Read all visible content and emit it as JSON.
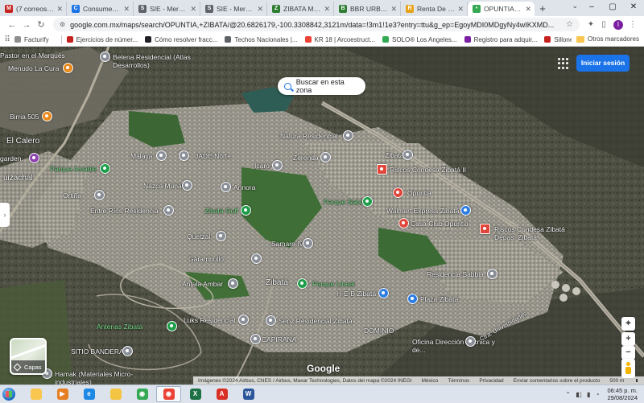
{
  "browser": {
    "tabs": [
      {
        "title": "(7 correos no",
        "icon": "gmail-icon",
        "color": "#c5221f",
        "glyph": "M"
      },
      {
        "title": "Consumer Pro",
        "icon": "consumer-icon",
        "color": "#1a73e8",
        "glyph": "C"
      },
      {
        "title": "SIE - Mercad",
        "icon": "sie-icon",
        "color": "#5f6368",
        "glyph": "S"
      },
      {
        "title": "SIE - Mercad",
        "icon": "sie-icon",
        "color": "#5f6368",
        "glyph": "S"
      },
      {
        "title": "ZIBATA MAPA",
        "icon": "zibata-icon",
        "color": "#2e7d32",
        "glyph": "Z"
      },
      {
        "title": "BBR URBAN C",
        "icon": "bbr-icon",
        "color": "#2e7d32",
        "glyph": "B"
      },
      {
        "title": "Renta De Dep",
        "icon": "renta-icon",
        "color": "#e8a317",
        "glyph": "R"
      },
      {
        "title": "OPUNTIA, ZIB",
        "icon": "maps-pin-icon",
        "color": "#34a853",
        "glyph": "•"
      }
    ],
    "new_tab": "+",
    "url": "google.com.mx/maps/search/OPUNTIA,+ZIBATA/@20.6826179,-100.3308842,3121m/data=!3m1!1e3?entry=ttu&g_ep=EgoyMDI0MDgyNy4wIKXMD...",
    "profile_initial": "I",
    "bookmarks": [
      {
        "label": "Facturify",
        "color": "#8e8e8e"
      },
      {
        "label": "Ejercicios de númer...",
        "color": "#c5221f"
      },
      {
        "label": "Cómo resolver fracc...",
        "color": "#202124"
      },
      {
        "label": "Techos Nacionales |...",
        "color": "#5f6368"
      },
      {
        "label": "KR 18 | Arcoestruct...",
        "color": "#ea4335"
      },
      {
        "label": "SOLO® Los Angeles...",
        "color": "#34a853"
      },
      {
        "label": "Registro para adquir...",
        "color": "#7b1fa2"
      },
      {
        "label": "Sillones | Costco M...",
        "color": "#c5221f"
      }
    ],
    "other_bookmarks": "Otros marcadores"
  },
  "map": {
    "search_area_label": "Buscar en esta zona",
    "sign_in_label": "Iniciar sesión",
    "layers_label": "Capas",
    "google_logo": "Google",
    "attribution": [
      "Imágenes ©2024 Airbus, CNES / Airbus, Maxar Technologies, Datos del mapa ©2024 INEGI",
      "México",
      "Términos",
      "Privacidad",
      "Enviar comentarios sobre el producto",
      "500 m"
    ],
    "labels": [
      {
        "text": "Pastor en el Marqués",
        "cls": ""
      },
      {
        "text": "Menudo La Cura",
        "cls": ""
      },
      {
        "text": "Belena Residencial (Atlas Desarrollos)",
        "cls": ""
      },
      {
        "text": "Birria 505",
        "cls": ""
      },
      {
        "text": "El Calero",
        "cls": "big"
      },
      {
        "text": "garden",
        "cls": ""
      },
      {
        "text": "uizachal",
        "cls": "big"
      },
      {
        "text": "Natura Residencial",
        "cls": ""
      },
      {
        "text": "Malaya",
        "cls": ""
      },
      {
        "text": "JADE Norte",
        "cls": ""
      },
      {
        "text": "Parque Amable",
        "cls": "green"
      },
      {
        "text": "Icaro",
        "cls": ""
      },
      {
        "text": "Zerenda",
        "cls": ""
      },
      {
        "text": "Zibatá",
        "cls": ""
      },
      {
        "text": "Riscos Condesa Zibatá II",
        "cls": ""
      },
      {
        "text": "Nazca Munay",
        "cls": ""
      },
      {
        "text": "Annora",
        "cls": ""
      },
      {
        "text": "Opuntia",
        "cls": ""
      },
      {
        "text": "Ortiña",
        "cls": ""
      },
      {
        "text": "Parque Sabino",
        "cls": "green"
      },
      {
        "text": "Entre Ríos Residencia",
        "cls": ""
      },
      {
        "text": "Zibatá Golf",
        "cls": "green"
      },
      {
        "text": "Walmart Express Zibatá",
        "cls": ""
      },
      {
        "text": "Casa Club Opuntia",
        "cls": ""
      },
      {
        "text": "Riscos Condesa Zibatá Depas. Zibatá",
        "cls": ""
      },
      {
        "text": "Quetzal",
        "cls": ""
      },
      {
        "text": "Samare IV",
        "cls": ""
      },
      {
        "text": "Garambullo",
        "cls": ""
      },
      {
        "text": "Residencia Sabbia",
        "cls": ""
      },
      {
        "text": "Antala Ambar",
        "cls": ""
      },
      {
        "text": "Zibatá",
        "cls": "big"
      },
      {
        "text": "Parque Lineal",
        "cls": "green"
      },
      {
        "text": "H-E-B Zibatá",
        "cls": ""
      },
      {
        "text": "Plaza Zibatá",
        "cls": ""
      },
      {
        "text": "Antenas Zibatá",
        "cls": "green"
      },
      {
        "text": "Luks Residencial",
        "cls": ""
      },
      {
        "text": "Senz Residencial Zibatá",
        "cls": ""
      },
      {
        "text": "DOMINIO",
        "cls": ""
      },
      {
        "text": "SITIO BANDERA",
        "cls": ""
      },
      {
        "text": "CAPIRANA",
        "cls": ""
      },
      {
        "text": "Oficina Dirección Técnica y de...",
        "cls": ""
      },
      {
        "text": "Ctra. Universidades",
        "cls": ""
      },
      {
        "text": "Hamak (Materiales Micro-industriales)",
        "cls": ""
      }
    ]
  },
  "taskbar": {
    "apps": [
      {
        "name": "explorer-app",
        "icon": "folder-icon",
        "color": "#f9c74f",
        "glyph": ""
      },
      {
        "name": "media-app",
        "icon": "play-icon",
        "color": "#e67e22",
        "glyph": "▶"
      },
      {
        "name": "ie-app",
        "icon": "ie-icon",
        "color": "#1e88e5",
        "glyph": "e"
      },
      {
        "name": "files-app",
        "icon": "folder-icon",
        "color": "#f4c542",
        "glyph": ""
      },
      {
        "name": "chrome-app",
        "icon": "chrome-icon",
        "color": "#34a853",
        "glyph": "◉"
      },
      {
        "name": "chrome-app-2",
        "icon": "chrome-icon",
        "color": "#ea4335",
        "glyph": "◉"
      },
      {
        "name": "excel-app",
        "icon": "excel-icon",
        "color": "#1e7145",
        "glyph": "X"
      },
      {
        "name": "acrobat-app",
        "icon": "pdf-icon",
        "color": "#d93025",
        "glyph": "A"
      },
      {
        "name": "word-app",
        "icon": "word-icon",
        "color": "#2b579a",
        "glyph": "W"
      }
    ],
    "time": "06:45 p. m.",
    "date": "29/08/2024"
  }
}
